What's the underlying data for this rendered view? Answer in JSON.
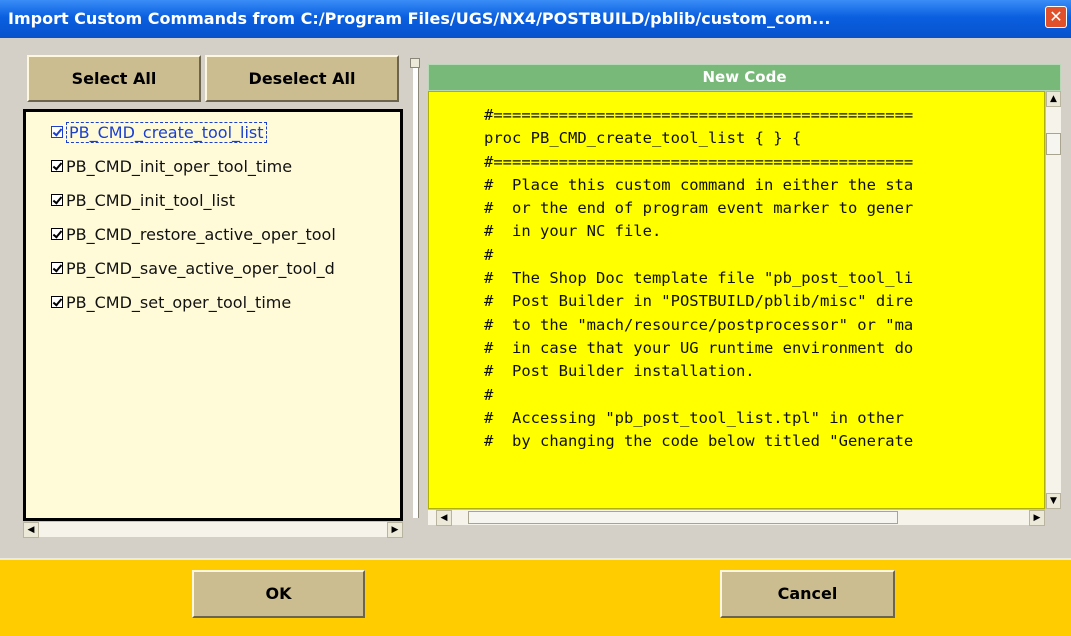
{
  "window": {
    "title": "Import Custom Commands from  C:/Program Files/UGS/NX4/POSTBUILD/pblib/custom_com...",
    "close_glyph": "✕"
  },
  "toolbar": {
    "select_all_label": "Select All",
    "deselect_all_label": "Deselect All"
  },
  "command_list": {
    "items": [
      {
        "label": "PB_CMD_create_tool_list",
        "checked": true,
        "selected": true
      },
      {
        "label": "PB_CMD_init_oper_tool_time",
        "checked": true
      },
      {
        "label": "PB_CMD_init_tool_list",
        "checked": true
      },
      {
        "label": "PB_CMD_restore_active_oper_tool",
        "checked": true
      },
      {
        "label": "PB_CMD_save_active_oper_tool_d",
        "checked": true
      },
      {
        "label": "PB_CMD_set_oper_tool_time",
        "checked": true
      }
    ]
  },
  "code_panel": {
    "header": "New Code",
    "lines": [
      "#=============================================",
      "proc PB_CMD_create_tool_list { } {",
      "#=============================================",
      "#  Place this custom command in either the sta",
      "#  or the end of program event marker to gener",
      "#  in your NC file.",
      "#",
      "#  The Shop Doc template file \"pb_post_tool_li",
      "#  Post Builder in \"POSTBUILD/pblib/misc\" dire",
      "#  to the \"mach/resource/postprocessor\" or \"ma",
      "#  in case that your UG runtime environment do",
      "#  Post Builder installation.",
      "#",
      "#  Accessing \"pb_post_tool_list.tpl\" in other",
      "#  by changing the code below titled \"Generate"
    ]
  },
  "scrollbar_glyphs": {
    "left": "◀",
    "right": "▶",
    "up": "▲",
    "down": "▼"
  },
  "footer": {
    "ok_label": "OK",
    "cancel_label": "Cancel"
  },
  "colors": {
    "title_bar": "#0a5fe0",
    "code_background": "#ffff00",
    "code_header": "#78b878",
    "list_background": "#fffbd9",
    "footer_background": "#ffcc00",
    "button_face": "#cbbd8f",
    "selection_text": "#1a3fcf"
  }
}
